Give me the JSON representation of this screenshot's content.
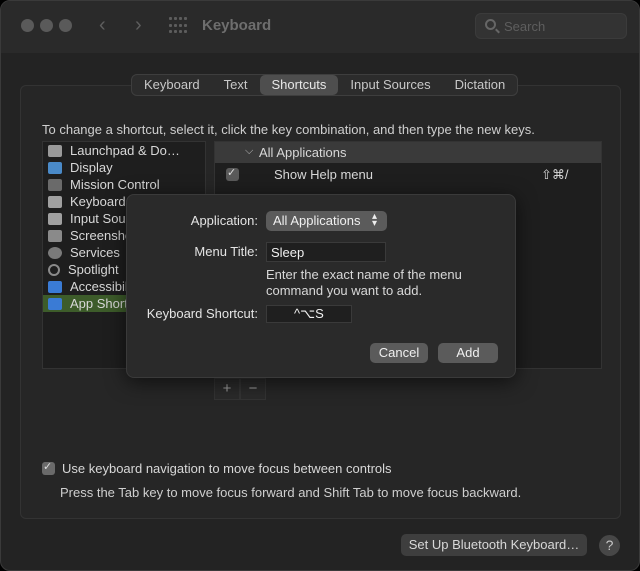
{
  "window": {
    "title": "Keyboard",
    "search_placeholder": "Search"
  },
  "tabs": [
    {
      "label": "Keyboard"
    },
    {
      "label": "Text"
    },
    {
      "label": "Shortcuts"
    },
    {
      "label": "Input Sources"
    },
    {
      "label": "Dictation"
    }
  ],
  "active_tab": "Shortcuts",
  "instructions": "To change a shortcut, select it, click the key combination, and then type the new keys.",
  "categories": [
    {
      "label": "Launchpad & Do…",
      "icon": "launchpad-icon"
    },
    {
      "label": "Display",
      "icon": "display-icon"
    },
    {
      "label": "Mission Control",
      "icon": "mission-control-icon"
    },
    {
      "label": "Keyboard",
      "icon": "keyboard-icon"
    },
    {
      "label": "Input Sou",
      "icon": "input-sources-icon"
    },
    {
      "label": "Screensho",
      "icon": "screenshot-icon"
    },
    {
      "label": "Services",
      "icon": "services-icon"
    },
    {
      "label": "Spotlight",
      "icon": "spotlight-icon"
    },
    {
      "label": "Accessibil",
      "icon": "accessibility-icon"
    },
    {
      "label": "App Short",
      "icon": "app-shortcuts-icon",
      "selected": true
    }
  ],
  "shortcuts": {
    "group_label": "All Applications",
    "items": [
      {
        "label": "Show Help menu",
        "keys": "⇧⌘/",
        "checked": true
      }
    ]
  },
  "list_controls": {
    "add": "+",
    "remove": "−"
  },
  "footer": {
    "kbnav_label": "Use keyboard navigation to move focus between controls",
    "kbnav_checked": true,
    "kbnav_sub": "Press the Tab key to move focus forward and Shift Tab to move focus backward.",
    "bluetooth_button": "Set Up Bluetooth Keyboard…",
    "help_button": "?"
  },
  "sheet": {
    "application_label": "Application:",
    "application_value": "All Applications",
    "menu_title_label": "Menu Title:",
    "menu_title_value": "Sleep",
    "hint": "Enter the exact name of the menu command you want to add.",
    "shortcut_label": "Keyboard Shortcut:",
    "shortcut_value": "^⌥S",
    "cancel": "Cancel",
    "add": "Add"
  },
  "colors": {
    "selection": "#3d5c2a",
    "window_bg": "#232323"
  }
}
